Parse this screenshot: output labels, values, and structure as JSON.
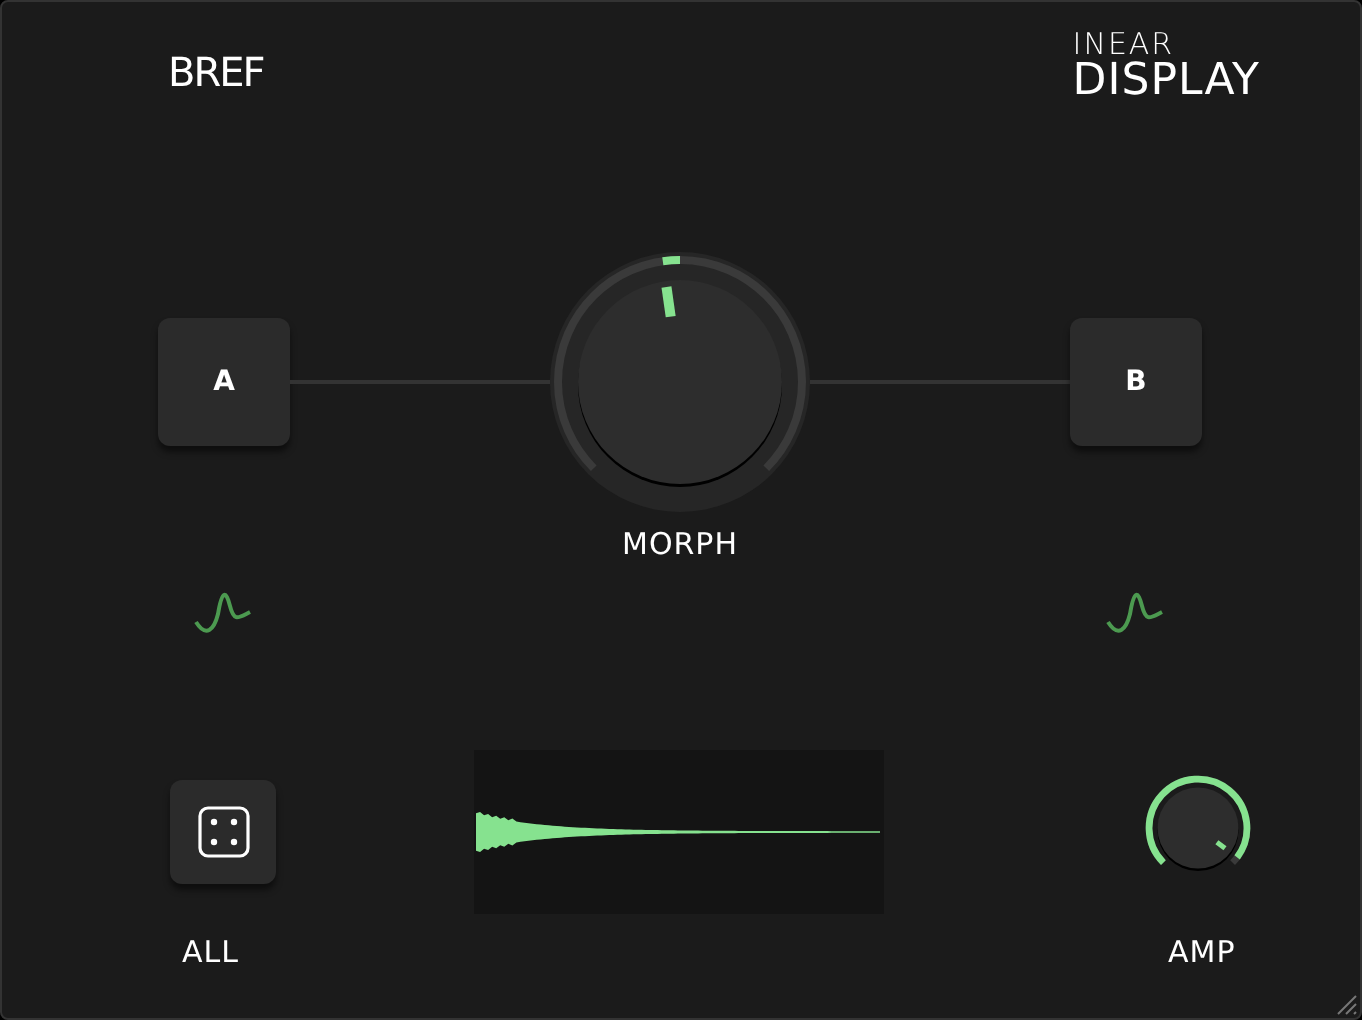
{
  "header": {
    "brand": "BREF",
    "logo_top": "INEAR",
    "logo_bottom": "DISPLAY"
  },
  "morph": {
    "slot_a": "A",
    "slot_b": "B",
    "label": "MORPH"
  },
  "randomize": {
    "label": "ALL"
  },
  "amp": {
    "label": "AMP"
  }
}
